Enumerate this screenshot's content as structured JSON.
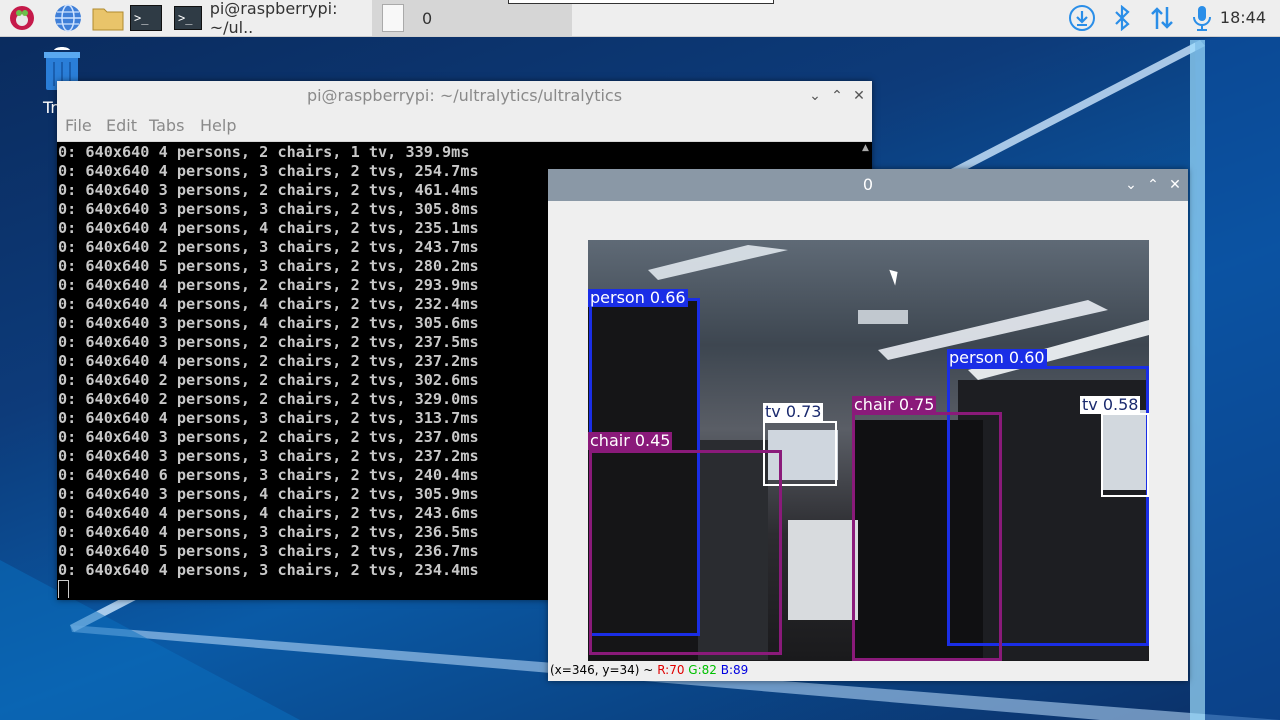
{
  "taskbar": {
    "tasks": [
      {
        "label": "pi@raspberrypi: ~/ul.."
      },
      {
        "label": "0"
      }
    ],
    "clock": "18:44"
  },
  "desktop": {
    "trash_label": "Tr"
  },
  "terminal": {
    "title": "pi@raspberrypi: ~/ultralytics/ultralytics",
    "menu": [
      "File",
      "Edit",
      "Tabs",
      "Help"
    ],
    "lines": [
      "0: 640x640 4 persons, 2 chairs, 1 tv, 339.9ms",
      "0: 640x640 4 persons, 3 chairs, 2 tvs, 254.7ms",
      "0: 640x640 3 persons, 2 chairs, 2 tvs, 461.4ms",
      "0: 640x640 3 persons, 3 chairs, 2 tvs, 305.8ms",
      "0: 640x640 4 persons, 4 chairs, 2 tvs, 235.1ms",
      "0: 640x640 2 persons, 3 chairs, 2 tvs, 243.7ms",
      "0: 640x640 5 persons, 3 chairs, 2 tvs, 280.2ms",
      "0: 640x640 4 persons, 2 chairs, 2 tvs, 293.9ms",
      "0: 640x640 4 persons, 4 chairs, 2 tvs, 232.4ms",
      "0: 640x640 3 persons, 4 chairs, 2 tvs, 305.6ms",
      "0: 640x640 3 persons, 2 chairs, 2 tvs, 237.5ms",
      "0: 640x640 4 persons, 2 chairs, 2 tvs, 237.2ms",
      "0: 640x640 2 persons, 2 chairs, 2 tvs, 302.6ms",
      "0: 640x640 2 persons, 2 chairs, 2 tvs, 329.0ms",
      "0: 640x640 4 persons, 3 chairs, 2 tvs, 313.7ms",
      "0: 640x640 3 persons, 2 chairs, 2 tvs, 237.0ms",
      "0: 640x640 3 persons, 3 chairs, 2 tvs, 237.2ms",
      "0: 640x640 6 persons, 3 chairs, 2 tvs, 240.4ms",
      "0: 640x640 3 persons, 4 chairs, 2 tvs, 305.9ms",
      "0: 640x640 4 persons, 4 chairs, 2 tvs, 243.6ms",
      "0: 640x640 4 persons, 3 chairs, 2 tvs, 236.5ms",
      "0: 640x640 5 persons, 3 chairs, 2 tvs, 236.7ms",
      "0: 640x640 4 persons, 3 chairs, 2 tvs, 234.4ms"
    ]
  },
  "image_window": {
    "title": "0",
    "detections": [
      {
        "label": "person 0.66",
        "color": "#1a2ee6"
      },
      {
        "label": "person 0.60",
        "color": "#1a2ee6"
      },
      {
        "label": "tv 0.73",
        "color": "#ffffff"
      },
      {
        "label": "tv 0.58",
        "color": "#ffffff"
      },
      {
        "label": "chair 0.75",
        "color": "#8a1a7a"
      },
      {
        "label": "chair 0.45",
        "color": "#8a1a7a"
      }
    ],
    "status": {
      "coords": "(x=346, y=34) ~",
      "r": "R:70",
      "g": "G:82",
      "b": "B:89",
      "r_color": "#e00000",
      "g_color": "#00c000",
      "b_color": "#0000e0"
    }
  }
}
